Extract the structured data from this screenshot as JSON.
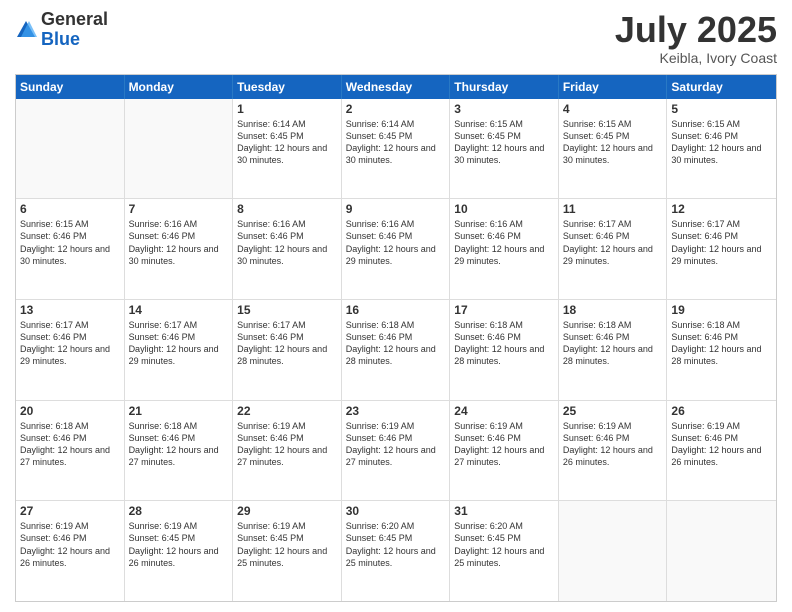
{
  "logo": {
    "general": "General",
    "blue": "Blue"
  },
  "header": {
    "month": "July 2025",
    "location": "Keibla, Ivory Coast"
  },
  "weekdays": [
    "Sunday",
    "Monday",
    "Tuesday",
    "Wednesday",
    "Thursday",
    "Friday",
    "Saturday"
  ],
  "rows": [
    [
      {
        "day": "",
        "info": ""
      },
      {
        "day": "",
        "info": ""
      },
      {
        "day": "1",
        "info": "Sunrise: 6:14 AM\nSunset: 6:45 PM\nDaylight: 12 hours and 30 minutes."
      },
      {
        "day": "2",
        "info": "Sunrise: 6:14 AM\nSunset: 6:45 PM\nDaylight: 12 hours and 30 minutes."
      },
      {
        "day": "3",
        "info": "Sunrise: 6:15 AM\nSunset: 6:45 PM\nDaylight: 12 hours and 30 minutes."
      },
      {
        "day": "4",
        "info": "Sunrise: 6:15 AM\nSunset: 6:45 PM\nDaylight: 12 hours and 30 minutes."
      },
      {
        "day": "5",
        "info": "Sunrise: 6:15 AM\nSunset: 6:46 PM\nDaylight: 12 hours and 30 minutes."
      }
    ],
    [
      {
        "day": "6",
        "info": "Sunrise: 6:15 AM\nSunset: 6:46 PM\nDaylight: 12 hours and 30 minutes."
      },
      {
        "day": "7",
        "info": "Sunrise: 6:16 AM\nSunset: 6:46 PM\nDaylight: 12 hours and 30 minutes."
      },
      {
        "day": "8",
        "info": "Sunrise: 6:16 AM\nSunset: 6:46 PM\nDaylight: 12 hours and 30 minutes."
      },
      {
        "day": "9",
        "info": "Sunrise: 6:16 AM\nSunset: 6:46 PM\nDaylight: 12 hours and 29 minutes."
      },
      {
        "day": "10",
        "info": "Sunrise: 6:16 AM\nSunset: 6:46 PM\nDaylight: 12 hours and 29 minutes."
      },
      {
        "day": "11",
        "info": "Sunrise: 6:17 AM\nSunset: 6:46 PM\nDaylight: 12 hours and 29 minutes."
      },
      {
        "day": "12",
        "info": "Sunrise: 6:17 AM\nSunset: 6:46 PM\nDaylight: 12 hours and 29 minutes."
      }
    ],
    [
      {
        "day": "13",
        "info": "Sunrise: 6:17 AM\nSunset: 6:46 PM\nDaylight: 12 hours and 29 minutes."
      },
      {
        "day": "14",
        "info": "Sunrise: 6:17 AM\nSunset: 6:46 PM\nDaylight: 12 hours and 29 minutes."
      },
      {
        "day": "15",
        "info": "Sunrise: 6:17 AM\nSunset: 6:46 PM\nDaylight: 12 hours and 28 minutes."
      },
      {
        "day": "16",
        "info": "Sunrise: 6:18 AM\nSunset: 6:46 PM\nDaylight: 12 hours and 28 minutes."
      },
      {
        "day": "17",
        "info": "Sunrise: 6:18 AM\nSunset: 6:46 PM\nDaylight: 12 hours and 28 minutes."
      },
      {
        "day": "18",
        "info": "Sunrise: 6:18 AM\nSunset: 6:46 PM\nDaylight: 12 hours and 28 minutes."
      },
      {
        "day": "19",
        "info": "Sunrise: 6:18 AM\nSunset: 6:46 PM\nDaylight: 12 hours and 28 minutes."
      }
    ],
    [
      {
        "day": "20",
        "info": "Sunrise: 6:18 AM\nSunset: 6:46 PM\nDaylight: 12 hours and 27 minutes."
      },
      {
        "day": "21",
        "info": "Sunrise: 6:18 AM\nSunset: 6:46 PM\nDaylight: 12 hours and 27 minutes."
      },
      {
        "day": "22",
        "info": "Sunrise: 6:19 AM\nSunset: 6:46 PM\nDaylight: 12 hours and 27 minutes."
      },
      {
        "day": "23",
        "info": "Sunrise: 6:19 AM\nSunset: 6:46 PM\nDaylight: 12 hours and 27 minutes."
      },
      {
        "day": "24",
        "info": "Sunrise: 6:19 AM\nSunset: 6:46 PM\nDaylight: 12 hours and 27 minutes."
      },
      {
        "day": "25",
        "info": "Sunrise: 6:19 AM\nSunset: 6:46 PM\nDaylight: 12 hours and 26 minutes."
      },
      {
        "day": "26",
        "info": "Sunrise: 6:19 AM\nSunset: 6:46 PM\nDaylight: 12 hours and 26 minutes."
      }
    ],
    [
      {
        "day": "27",
        "info": "Sunrise: 6:19 AM\nSunset: 6:46 PM\nDaylight: 12 hours and 26 minutes."
      },
      {
        "day": "28",
        "info": "Sunrise: 6:19 AM\nSunset: 6:45 PM\nDaylight: 12 hours and 26 minutes."
      },
      {
        "day": "29",
        "info": "Sunrise: 6:19 AM\nSunset: 6:45 PM\nDaylight: 12 hours and 25 minutes."
      },
      {
        "day": "30",
        "info": "Sunrise: 6:20 AM\nSunset: 6:45 PM\nDaylight: 12 hours and 25 minutes."
      },
      {
        "day": "31",
        "info": "Sunrise: 6:20 AM\nSunset: 6:45 PM\nDaylight: 12 hours and 25 minutes."
      },
      {
        "day": "",
        "info": ""
      },
      {
        "day": "",
        "info": ""
      }
    ]
  ]
}
